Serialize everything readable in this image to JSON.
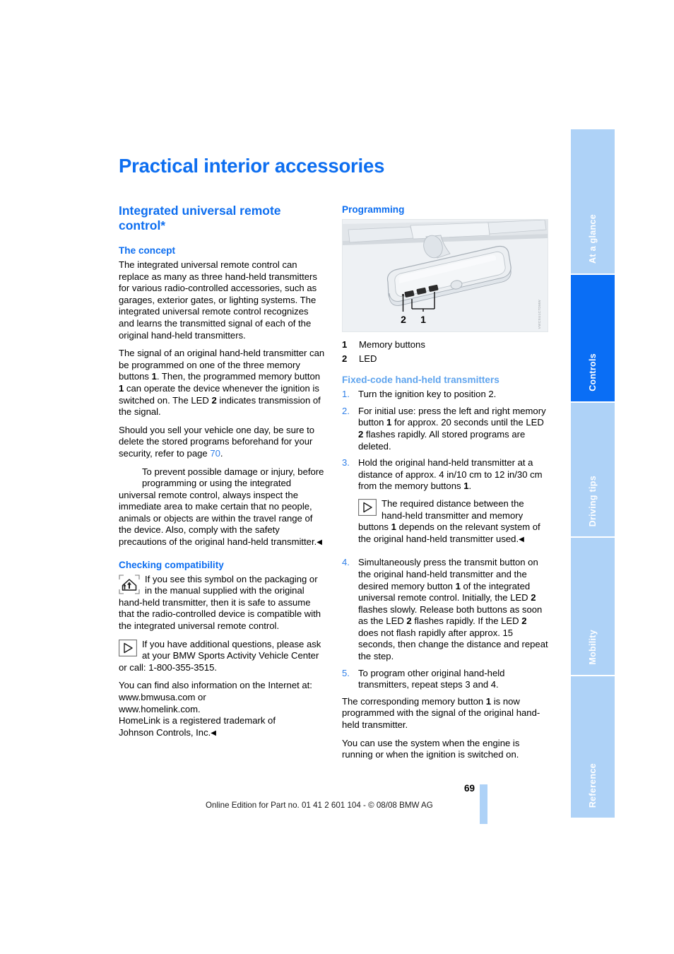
{
  "document": {
    "page_title": "Practical interior accessories",
    "page_number": "69",
    "footer": "Online Edition for Part no. 01 41 2 601 104 - © 08/08 BMW AG"
  },
  "sidebar": {
    "tabs": [
      {
        "label": "At a glance",
        "active": false
      },
      {
        "label": "Controls",
        "active": true
      },
      {
        "label": "Driving tips",
        "active": false
      },
      {
        "label": "Mobility",
        "active": false
      },
      {
        "label": "Reference",
        "active": false
      }
    ]
  },
  "left_column": {
    "section_heading": "Integrated universal remote control*",
    "concept": {
      "heading": "The concept",
      "paragraph_1": "The integrated universal remote control can replace as many as three hand-held transmitters for various radio-controlled accessories, such as garages, exterior gates, or lighting systems. The integrated universal remote control recognizes and learns the transmitted signal of each of the original hand-held transmitters.",
      "paragraph_2_a": "The signal of an original hand-held transmitter can be programmed on one of the three memory buttons ",
      "paragraph_2_b": "1",
      "paragraph_2_c": ". Then, the programmed memory button ",
      "paragraph_2_d": "1",
      "paragraph_2_e": " can operate the device whenever the ignition is switched on. The LED ",
      "paragraph_2_f": "2",
      "paragraph_2_g": " indicates transmission of the signal.",
      "paragraph_3_a": "Should you sell your vehicle one day, be sure to delete the stored programs beforehand for your security, refer to page ",
      "paragraph_3_page": "70",
      "paragraph_3_b": "."
    },
    "warning": {
      "icon": "warning-triangle-icon",
      "text": "To prevent possible damage or injury, before programming or using the integrated universal remote control, always inspect the immediate area to make certain that no people, animals or objects are within the travel range of the device. Also, comply with the safety precautions of the original hand-held transmitter.",
      "end_mark": "◀"
    },
    "compatibility": {
      "heading": "Checking compatibility",
      "icon": "homelink-house-icon",
      "text": "If you see this symbol on the packaging or in the manual supplied with the original hand-held transmitter, then it is safe to assume that the radio-controlled device is compatible with the integrated universal remote control."
    },
    "contact": {
      "icon": "note-pointer-icon",
      "line_1": "If you have additional questions, please ask at your BMW Sports Activity Vehicle Center or call: 1-800-355-3515.",
      "line_2": "You can find also information on the Internet at:",
      "line_3": "www.bmwusa.com or",
      "line_4": "www.homelink.com.",
      "line_5": "HomeLink is a registered trademark of",
      "line_6": "Johnson Controls, Inc.",
      "end_mark": "◀"
    }
  },
  "right_column": {
    "programming_heading": "Programming",
    "figure": {
      "alt": "rear-view-mirror-illustration",
      "callout_left": "2",
      "callout_right": "1",
      "image_code": "VWCSU1C7DMW"
    },
    "legend": [
      {
        "num": "1",
        "label": "Memory buttons"
      },
      {
        "num": "2",
        "label": "LED"
      }
    ],
    "fixed_code": {
      "heading": "Fixed-code hand-held transmitters",
      "steps": [
        {
          "num": "1.",
          "text": "Turn the ignition key to position 2."
        },
        {
          "num": "2.",
          "parts": [
            {
              "t": "For initial use: press the left and right memory button "
            },
            {
              "t": "1",
              "b": true
            },
            {
              "t": " for approx. 20 seconds until the LED "
            },
            {
              "t": "2",
              "b": true
            },
            {
              "t": " flashes rapidly. All stored programs are deleted."
            }
          ]
        },
        {
          "num": "3.",
          "parts": [
            {
              "t": "Hold the original hand-held transmitter at a distance of approx. 4 in/10 cm to 12 in/30 cm from the memory buttons "
            },
            {
              "t": "1",
              "b": true
            },
            {
              "t": "."
            }
          ],
          "note": {
            "icon": "note-pointer-icon",
            "parts": [
              {
                "t": "The required distance between the hand-held transmitter and memory buttons "
              },
              {
                "t": "1",
                "b": true
              },
              {
                "t": " depends on the relevant system of the original hand-held transmitter used."
              }
            ],
            "end_mark": "◀"
          }
        },
        {
          "num": "4.",
          "parts": [
            {
              "t": "Simultaneously press the transmit button on the original hand-held transmitter and the desired memory button "
            },
            {
              "t": "1",
              "b": true
            },
            {
              "t": " of the integrated universal remote control. Initially, the LED "
            },
            {
              "t": "2",
              "b": true
            },
            {
              "t": " flashes slowly. Release both buttons as soon as the LED "
            },
            {
              "t": "2",
              "b": true
            },
            {
              "t": " flashes rapidly. If the LED "
            },
            {
              "t": "2",
              "b": true
            },
            {
              "t": " does not flash rapidly after approx. 15 seconds, then change the distance and repeat the step."
            }
          ]
        },
        {
          "num": "5.",
          "text": "To program other original hand-held transmitters, repeat steps 3 and 4."
        }
      ],
      "closing_1_a": "The corresponding memory button ",
      "closing_1_b": "1",
      "closing_1_c": " is now programmed with the signal of the original hand-held transmitter.",
      "closing_2": "You can use the system when the engine is running or when the ignition is switched on."
    }
  },
  "colors": {
    "heading_blue": "#0d6ef0",
    "light_heading_blue": "#5fa4ee",
    "tab_inactive": "#aed2f7",
    "tab_active": "#0a6ef5",
    "figure_bg": "#eef1f4"
  }
}
